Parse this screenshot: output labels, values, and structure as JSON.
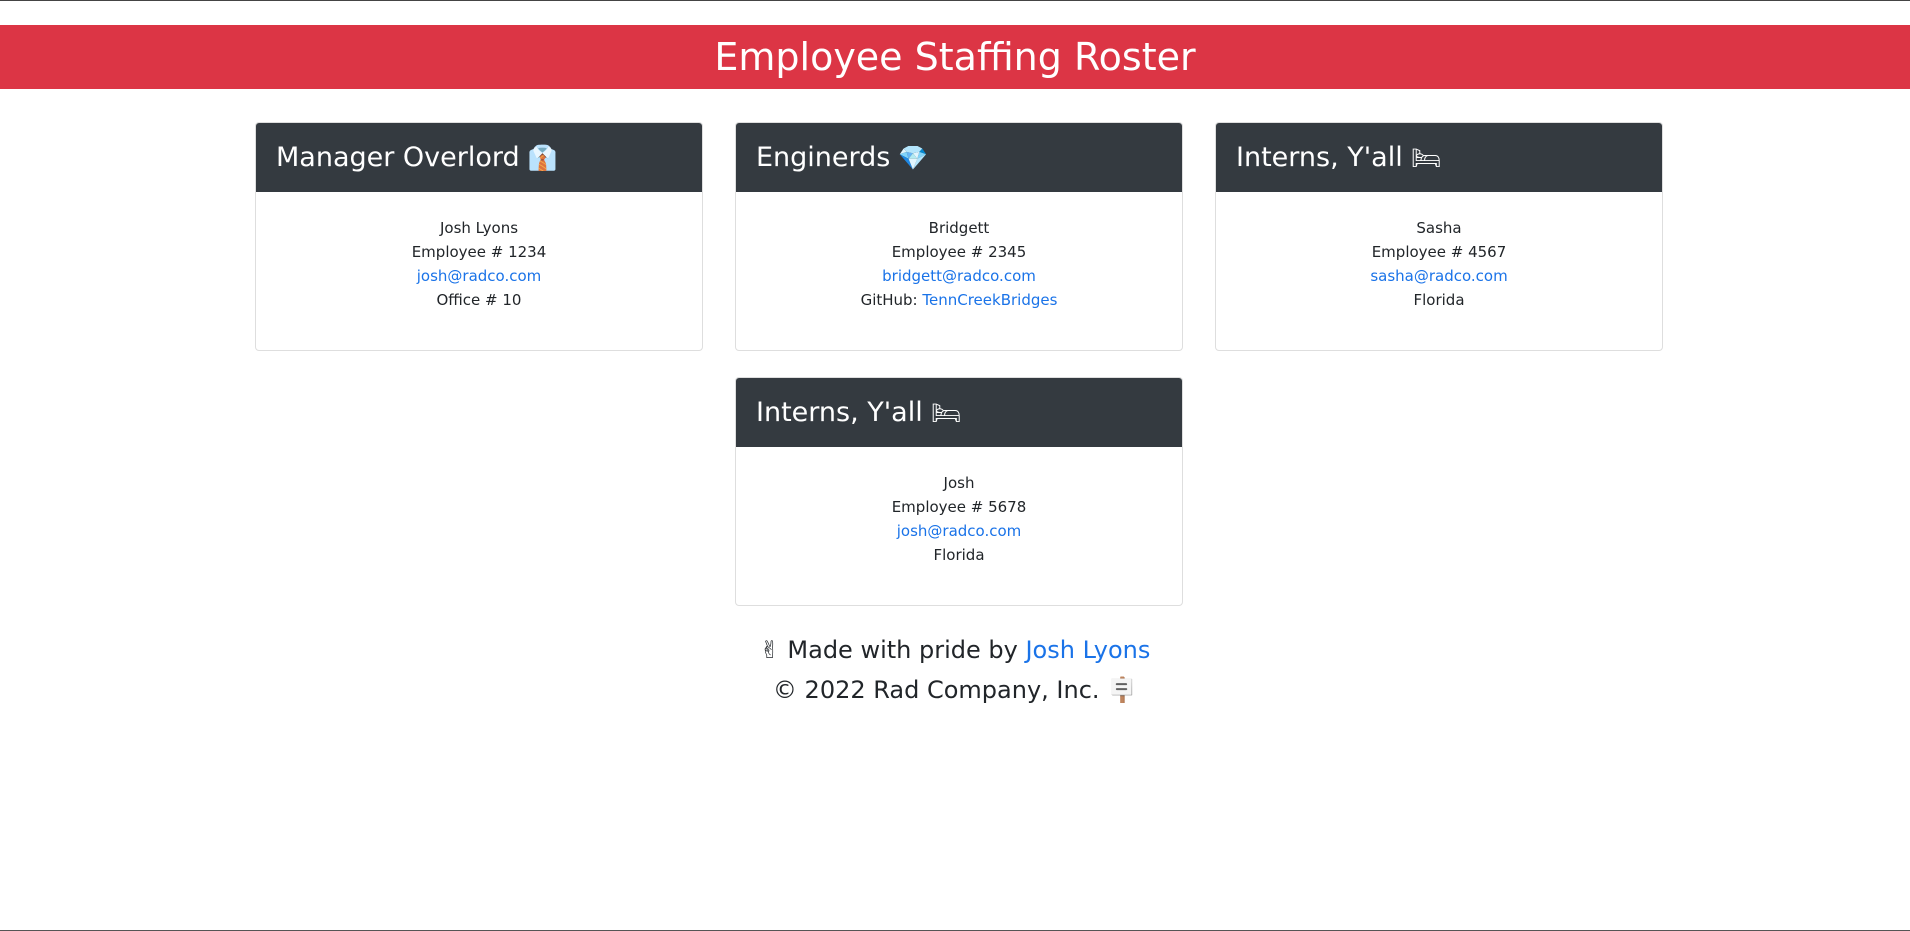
{
  "header": {
    "title": "Employee Staffing Roster"
  },
  "cards": [
    {
      "title": "Manager Overlord",
      "icon": "👔",
      "icon_name": "necktie-icon",
      "name": "Josh Lyons",
      "id_line": "Employee # 1234",
      "email": "josh@radco.com",
      "extra_line": "Office # 10"
    },
    {
      "title": "Enginerds",
      "icon": "💎",
      "icon_name": "gem-icon",
      "name": "Bridgett",
      "id_line": "Employee # 2345",
      "email": "bridgett@radco.com",
      "extra_label": "GitHub: ",
      "extra_link": "TennCreekBridges"
    },
    {
      "title": "Interns, Y'all",
      "icon": "🛏",
      "icon_name": "bed-icon",
      "name": "Sasha",
      "id_line": "Employee # 4567",
      "email": "sasha@radco.com",
      "extra_line": "Florida"
    },
    {
      "title": "Interns, Y'all",
      "icon": "🛏",
      "icon_name": "bed-icon",
      "name": "Josh",
      "id_line": "Employee # 5678",
      "email": "josh@radco.com",
      "extra_line": "Florida"
    }
  ],
  "footer": {
    "pride_icon": "✌",
    "made_with": "Made with pride by ",
    "author": "Josh Lyons",
    "copyright": "© 2022 Rad Company, Inc.",
    "end_icon": "🪧"
  },
  "colors": {
    "header_bg": "#dc3545",
    "card_header_bg": "#343a40",
    "link": "#1a73e8"
  }
}
